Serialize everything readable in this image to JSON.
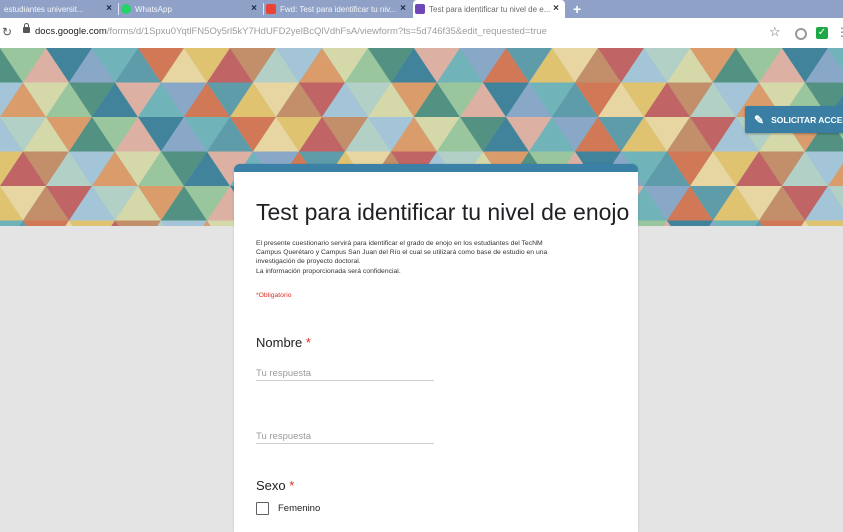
{
  "tabs": [
    {
      "label": "estudiantes universit...",
      "active": false
    },
    {
      "label": "WhatsApp",
      "active": false
    },
    {
      "label": "Fwd: Test para identificar tu niv...",
      "active": false
    },
    {
      "label": "Test para identificar tu nivel de e...",
      "active": true
    }
  ],
  "addressbar": {
    "domain": "docs.google.com",
    "path": "/forms/d/1Spxu0YqtlFN5Oy5rl5kY7HdUFD2yelBcQlVdhFsA/viewform?ts=5d746f35&edit_requested=true"
  },
  "header": {
    "request_button_label": "SOLICITAR ACCES"
  },
  "form": {
    "title": "Test para identificar tu nivel de enojo",
    "description": [
      "El presente cuestionario servirá para identificar el grado de enojo en los estudiantes del TecNM",
      "Campus Querétaro y Campus San Juan del Río el cual se utilizará como base de estudio en una",
      "investigación de proyecto doctoral.",
      "La información proporcionada será confidencial."
    ],
    "required_note": "*Obligatorio",
    "questions": [
      {
        "label": "Nombre",
        "required_mark": "*",
        "placeholder": "Tu respuesta"
      },
      {
        "label": "",
        "placeholder": "Tu respuesta"
      },
      {
        "label": "Sexo",
        "required_mark": "*",
        "options": [
          "Femenino"
        ]
      }
    ]
  },
  "colors": {
    "accent": "#3b80a6",
    "required": "#d93025",
    "tabstrip": "#8fa1c6"
  }
}
